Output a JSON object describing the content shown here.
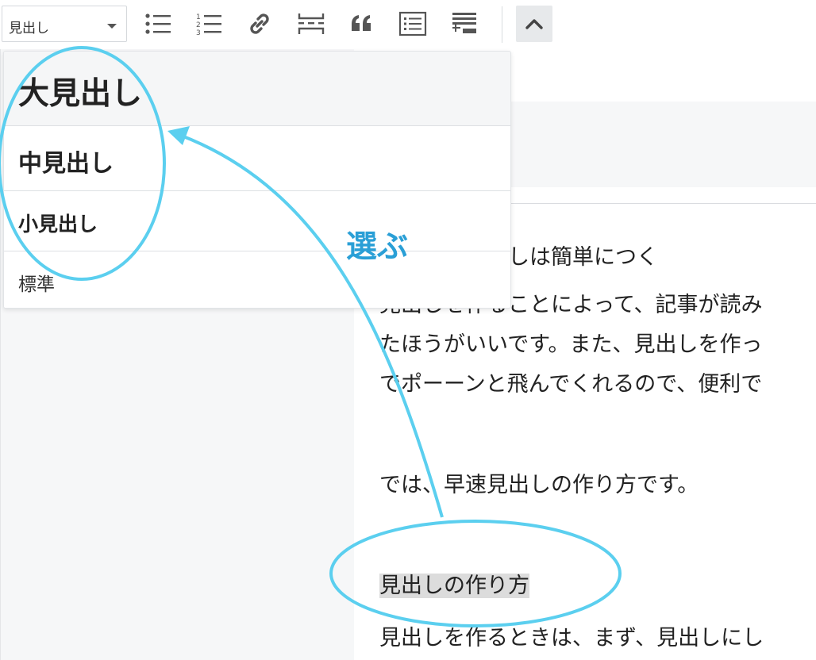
{
  "toolbar": {
    "format_select_value": "見出し",
    "buttons": [
      {
        "name": "bulleted-list-icon"
      },
      {
        "name": "numbered-list-icon"
      },
      {
        "name": "link-icon"
      },
      {
        "name": "read-more-icon"
      },
      {
        "name": "blockquote-icon"
      },
      {
        "name": "table-of-contents-icon"
      },
      {
        "name": "toolbar-toggle-icon"
      }
    ],
    "collapse_icon": "chevron-up-icon"
  },
  "dropdown": {
    "options": [
      {
        "label": "大見出し"
      },
      {
        "label": "中見出し"
      },
      {
        "label": "小見出し"
      },
      {
        "label": "標準"
      }
    ]
  },
  "annotation": {
    "label": "選ぶ",
    "color": "#2a9fd6",
    "stroke_color": "#5bcfef"
  },
  "editor": {
    "paragraphs": [
      "グでは、見出しは簡単につく",
      "見出しを作ることによって、記事が読み",
      "たほうがいいです。また、見出しを作っ",
      "でポーーンと飛んでくれるので、便利で",
      "では、早速見出しの作り方です。",
      "見出しの作り方",
      "見出しを作るときは、まず、見出しにし"
    ]
  }
}
